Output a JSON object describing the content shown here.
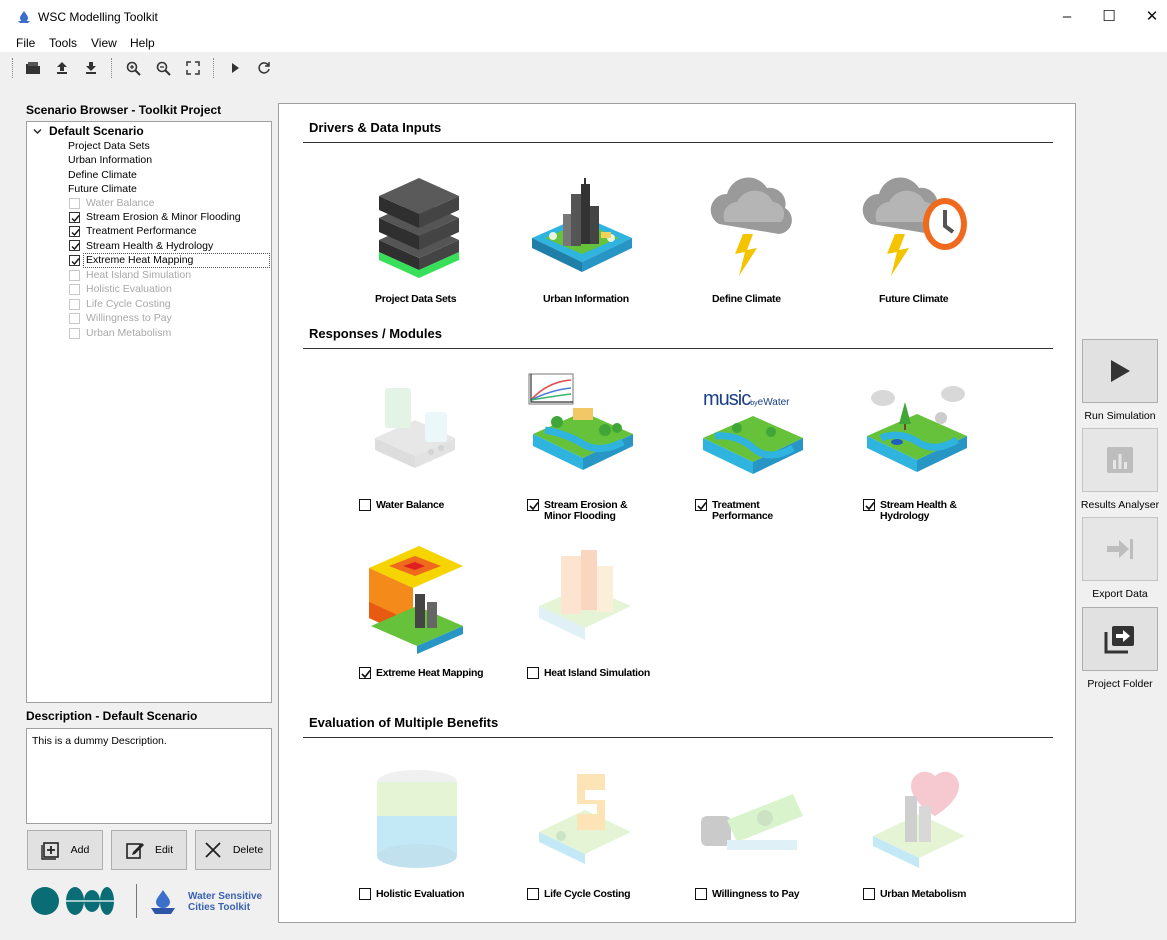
{
  "window": {
    "title": "WSC Modelling Toolkit",
    "controls": [
      "–",
      "☐",
      "✕"
    ]
  },
  "menu": [
    "File",
    "Tools",
    "View",
    "Help"
  ],
  "toolbar_icons": [
    "open-folder-icon",
    "upload-icon",
    "download-icon",
    "zoom-in-icon",
    "zoom-out-icon",
    "fit-view-icon",
    "play-icon",
    "refresh-icon"
  ],
  "scenario_browser": {
    "title": "Scenario Browser - Toolkit Project",
    "root": "Default Scenario",
    "items": [
      {
        "label": "Project Data Sets"
      },
      {
        "label": "Urban Information"
      },
      {
        "label": "Define Climate"
      },
      {
        "label": "Future Climate"
      }
    ],
    "modules": [
      {
        "label": "Water Balance",
        "checked": false,
        "enabled": false
      },
      {
        "label": "Stream Erosion & Minor Flooding",
        "checked": true,
        "enabled": true
      },
      {
        "label": "Treatment Performance",
        "checked": true,
        "enabled": true
      },
      {
        "label": "Stream Health & Hydrology",
        "checked": true,
        "enabled": true
      },
      {
        "label": "Extreme Heat Mapping",
        "checked": true,
        "enabled": true,
        "selected": true
      },
      {
        "label": "Heat Island Simulation",
        "checked": false,
        "enabled": false
      },
      {
        "label": "Holistic Evaluation",
        "checked": false,
        "enabled": false
      },
      {
        "label": "Life Cycle Costing",
        "checked": false,
        "enabled": false
      },
      {
        "label": "Willingness to Pay",
        "checked": false,
        "enabled": false
      },
      {
        "label": "Urban Metabolism",
        "checked": false,
        "enabled": false
      }
    ]
  },
  "description": {
    "title": "Description - Default Scenario",
    "text": "This is a dummy Description."
  },
  "buttons": {
    "add": "Add",
    "edit": "Edit",
    "delete": "Delete"
  },
  "brand": {
    "line1": "Water Sensitive",
    "line2": "Cities Toolkit"
  },
  "sections": {
    "drivers": {
      "title": "Drivers & Data Inputs",
      "tiles": [
        {
          "label": "Project Data Sets"
        },
        {
          "label": "Urban Information"
        },
        {
          "label": "Define Climate"
        },
        {
          "label": "Future Climate"
        }
      ]
    },
    "responses": {
      "title": "Responses / Modules",
      "tiles": [
        {
          "line1": "Water Balance",
          "line2": "",
          "checked": false
        },
        {
          "line1": "Stream Erosion &",
          "line2": "Minor Flooding",
          "checked": true
        },
        {
          "line1": "Treatment",
          "line2": "Performance",
          "checked": true
        },
        {
          "line1": "Stream Health &",
          "line2": "Hydrology",
          "checked": true
        },
        {
          "line1": "Extreme Heat Mapping",
          "line2": "",
          "checked": true
        },
        {
          "line1": "Heat Island Simulation",
          "line2": "",
          "checked": false
        }
      ],
      "music_logo": {
        "word": "music",
        "by": "by",
        "brand": "eWater"
      }
    },
    "evaluation": {
      "title": "Evaluation of Multiple Benefits",
      "tiles": [
        {
          "label": "Holistic Evaluation",
          "checked": false
        },
        {
          "label": "Life Cycle Costing",
          "checked": false
        },
        {
          "label": "Willingness to Pay",
          "checked": false
        },
        {
          "label": "Urban Metabolism",
          "checked": false
        }
      ]
    }
  },
  "side_actions": [
    {
      "label": "Run Simulation",
      "enabled": true
    },
    {
      "label": "Results Analyser",
      "enabled": false
    },
    {
      "label": "Export Data",
      "enabled": false
    },
    {
      "label": "Project Folder",
      "enabled": true
    }
  ],
  "colors": {
    "water": "#2fb4e0",
    "grass": "#66c23a",
    "cloud": "#9a9a9a",
    "lightning": "#f5c400",
    "clock": "#f06a1e",
    "server": "#3a3a3a",
    "server_glow": "#38e05a",
    "music_blue": "#1b3f8a"
  }
}
